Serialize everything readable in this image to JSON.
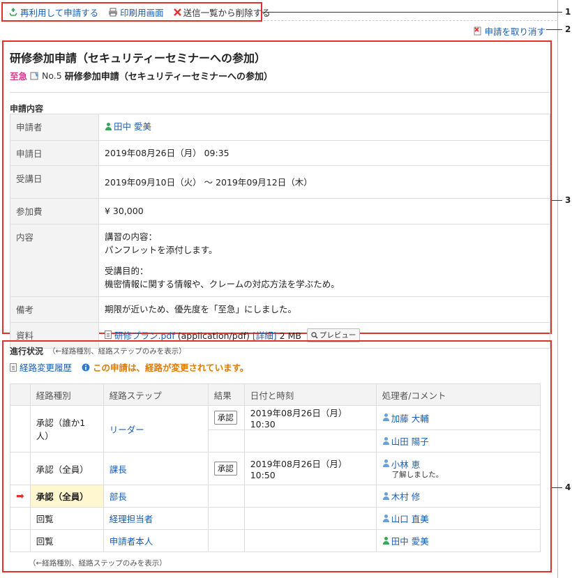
{
  "toolbar": {
    "reuse_label": "再利用して申請する",
    "print_label": "印刷用画面",
    "delete_label": "送信一覧から削除する"
  },
  "cancel_label": "申請を取り消す",
  "callouts": [
    "1",
    "2",
    "3",
    "4"
  ],
  "request": {
    "title": "研修参加申請（セキュリティーセミナーへの参加）",
    "priority": "至急",
    "number": "No.5",
    "sub_title": "研修参加申請（セキュリティーセミナーへの参加）",
    "section_label": "申請内容",
    "fields": {
      "applicant_key": "申請者",
      "applicant_value": "田中 愛美",
      "date_key": "申請日",
      "date_value": "2019年08月26日（月） 09:35",
      "course_key": "受講日",
      "course_value": "2019年09月10日（火） ～ 2019年09月12日（木）",
      "fee_key": "参加費",
      "fee_value": "¥ 30,000",
      "content_key": "内容",
      "content_line1": "講習の内容：",
      "content_line2": "パンフレットを添付します。",
      "content_line3": "受講目的：",
      "content_line4": "機密情報に関する情報や、クレームの対応方法を学ぶため。",
      "note_key": "備考",
      "note_value": "期限が近いため、優先度を「至急」にしました。",
      "file_key": "資料",
      "file_name": "研修プラン.pdf",
      "file_type": "(application/pdf)",
      "file_detail": "[詳細]",
      "file_size": "2 MB",
      "preview_label": "プレビュー"
    }
  },
  "progress": {
    "label": "進行状況",
    "filter_link": "（←経路種別、経路ステップのみを表示）",
    "history_label": "経路変更履歴",
    "notice": "この申請は、経路が変更されています。",
    "headers": {
      "type": "経路種別",
      "step": "経路ステップ",
      "result": "結果",
      "datetime": "日付と時刻",
      "handler": "処理者/コメント"
    },
    "rows": {
      "r1_type": "承認（誰か1人）",
      "r1_step": "リーダー",
      "r1_result": "承認",
      "r1_datetime": "2019年08月26日（月） 10:30",
      "r1_user1": "加藤 大輔",
      "r1_user2": "山田 陽子",
      "r2_type": "承認（全員）",
      "r2_step": "課長",
      "r2_result": "承認",
      "r2_datetime": "2019年08月26日（月） 10:50",
      "r2_user": "小林 恵",
      "r2_comment": "了解しました。",
      "r3_type": "承認（全員）",
      "r3_step": "部長",
      "r3_user": "木村 修",
      "r4_type": "回覧",
      "r4_step": "経理担当者",
      "r4_user": "山口 直美",
      "r5_type": "回覧",
      "r5_step": "申請者本人",
      "r5_user": "田中 愛美"
    },
    "bottom_link": "（←経路種別、経路ステップのみを表示）"
  },
  "colors": {
    "highlight_border": "#e0322d",
    "link": "#1a5fb4",
    "urgent": "#d63a8a",
    "notice": "#e07a00"
  }
}
